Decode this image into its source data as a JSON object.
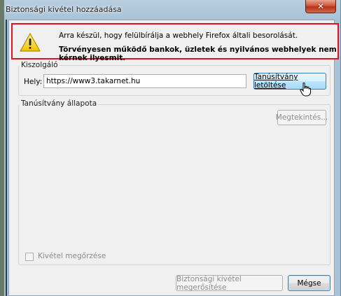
{
  "window": {
    "title": "Biztonsági kivétel hozzáadása",
    "close_symbol": "✕"
  },
  "warning": {
    "icon": "warning-triangle-icon",
    "line1": "Arra készül, hogy felülbírálja a webhely Firefox általi besorolását.",
    "line2": "Törvényesen működő bankok, üzletek és nyilvános webhelyek nem kérnek ilyesmit."
  },
  "server": {
    "group_label": "Kiszolgáló",
    "location_label": "Hely:",
    "url_value": "https://www3.takarnet.hu",
    "download_button_label": "Tanúsítvány letöltése"
  },
  "cert_status": {
    "group_label": "Tanúsítvány állapota",
    "view_button_label": "Megtekintés..."
  },
  "keep_exception": {
    "label": "Kivétel megőrzése",
    "checked": false
  },
  "footer": {
    "confirm_button_label": "Biztonsági kivétel megerősítése",
    "cancel_button_label": "Mégse"
  },
  "colors": {
    "highlight_border": "#e0141e",
    "title_bar": "#b9cfe0",
    "close_button": "#c94a30"
  }
}
